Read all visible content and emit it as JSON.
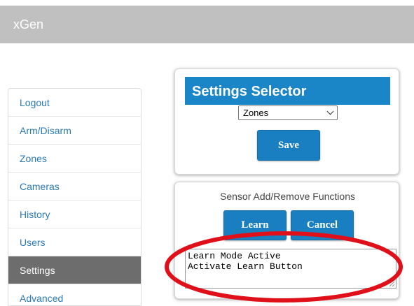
{
  "header": {
    "app_title": "xGen"
  },
  "sidebar": {
    "items": [
      {
        "label": "Logout",
        "active": false
      },
      {
        "label": "Arm/Disarm",
        "active": false
      },
      {
        "label": "Zones",
        "active": false
      },
      {
        "label": "Cameras",
        "active": false
      },
      {
        "label": "History",
        "active": false
      },
      {
        "label": "Users",
        "active": false
      },
      {
        "label": "Settings",
        "active": true
      },
      {
        "label": "Advanced",
        "active": false
      }
    ]
  },
  "settings_selector": {
    "title": "Settings Selector",
    "selected": "Zones",
    "save_label": "Save"
  },
  "sensor_functions": {
    "title": "Sensor Add/Remove Functions",
    "learn_label": "Learn",
    "cancel_label": "Cancel",
    "log_lines": [
      "Learn Mode Active",
      "Activate Learn Button"
    ]
  },
  "colors": {
    "accent": "#1a86c8",
    "button": "#1a7fc0",
    "link": "#2a7ab8",
    "active_nav": "#6d6d6d",
    "topbar": "#c0c0c0",
    "highlight": "#e0101a"
  },
  "icons": {
    "select_arrow": "chevron-down-icon",
    "resize": "resize-grip-icon"
  }
}
